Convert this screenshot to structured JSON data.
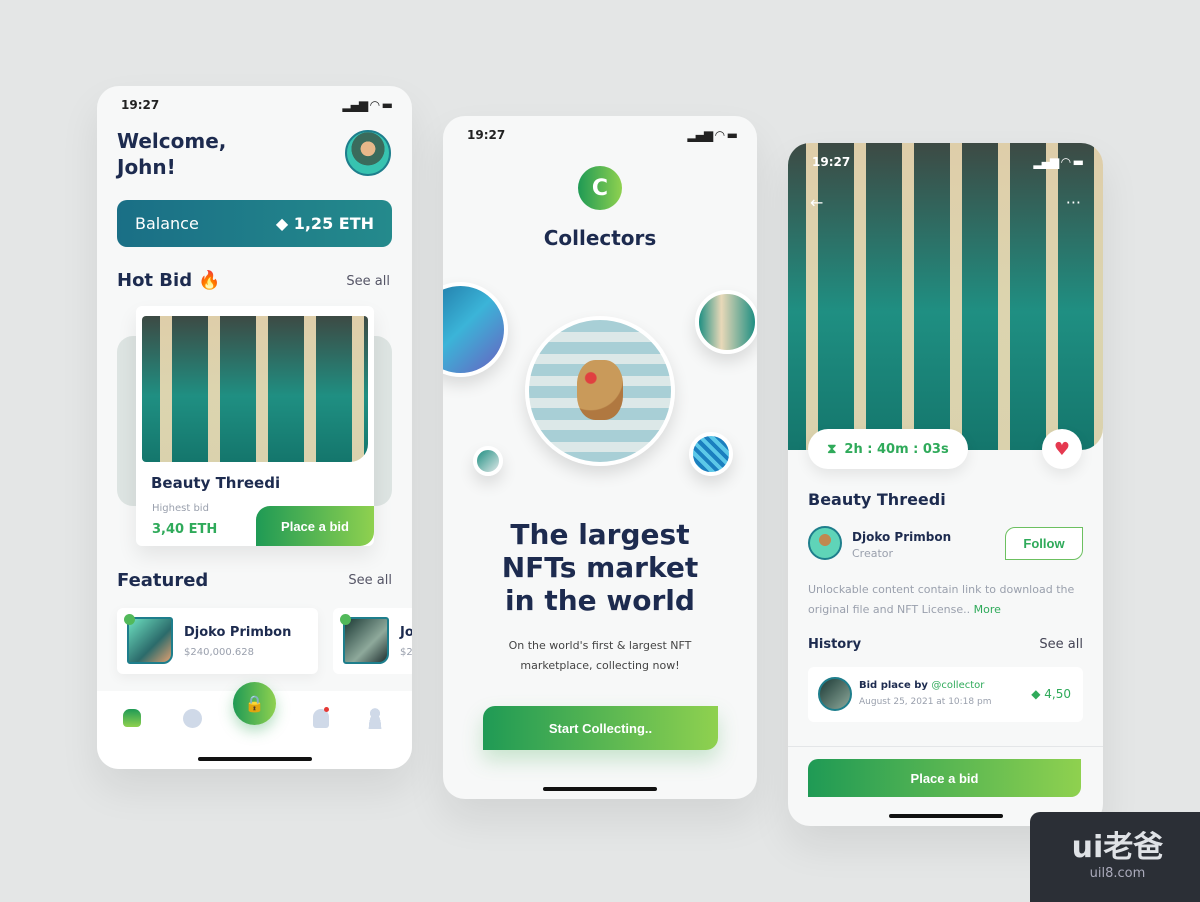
{
  "home": {
    "time": "19:27",
    "welcome": "Welcome,",
    "name": "John!",
    "balance_label": "Balance",
    "balance_value": "1,25 ETH",
    "hot_bid": "Hot Bid",
    "hot_emoji": "🔥",
    "see_all": "See all",
    "card_title": "Beauty Threedi",
    "highest_bid_label": "Highest bid",
    "highest_bid_value": "3,40 ETH",
    "place_bid": "Place a bid",
    "featured": "Featured",
    "featured_see_all": "See all",
    "featured_items": [
      {
        "name": "Djoko Primbon",
        "value": "$240,000.628"
      },
      {
        "name": "Jo",
        "value": "$2"
      }
    ]
  },
  "onboard": {
    "time": "19:27",
    "logo_letter": "C",
    "app_name": "Collectors",
    "headline": "The largest NFTs market in the world",
    "subtitle": "On the world's first & largest NFT marketplace, collecting now!",
    "cta": "Start Collecting.."
  },
  "detail": {
    "time": "19:27",
    "timer": "2h : 40m : 03s",
    "title": "Beauty Threedi",
    "creator_name": "Djoko Primbon",
    "creator_role": "Creator",
    "follow": "Follow",
    "description": "Unlockable content contain link to download the original file and NFT License..",
    "more": "More",
    "history": "History",
    "see_all": "See all",
    "bid_prefix": "Bid place by",
    "bid_user": "@collector",
    "bid_date": "August 25, 2021 at 10:18 pm",
    "bid_amount": "4,50",
    "place_bid": "Place a bid"
  },
  "watermark": {
    "brand": "ui老爸",
    "url": "uil8.com"
  },
  "colors": {
    "accent": "#2faa5a",
    "teal": "#1e7e8c",
    "navy": "#1d2b4f"
  }
}
